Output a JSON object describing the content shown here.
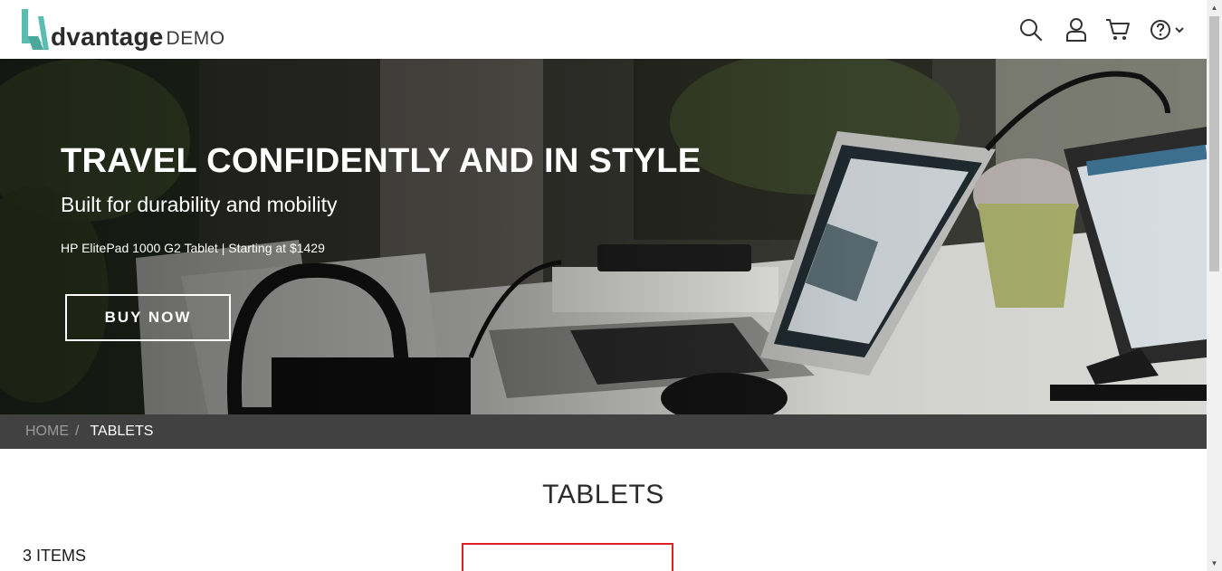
{
  "header": {
    "logo_word": "dvantage",
    "logo_demo": "DEMO",
    "icons": [
      "search-icon",
      "user-icon",
      "cart-icon",
      "help-icon",
      "chevron-down-icon"
    ]
  },
  "hero": {
    "title": "TRAVEL CONFIDENTLY AND IN STYLE",
    "subtitle": "Built for durability and mobility",
    "product_line": "HP ElitePad 1000 G2 Tablet | Starting at $1429",
    "button_label": "BUY NOW"
  },
  "breadcrumb": {
    "home": "HOME",
    "separator": "/",
    "current": "TABLETS"
  },
  "category": {
    "title": "TABLETS",
    "items_count": "3 ITEMS"
  },
  "colors": {
    "brand_teal": "#5bbcb0",
    "breadcrumb_bg": "#414141",
    "highlight_border": "#e02020"
  }
}
